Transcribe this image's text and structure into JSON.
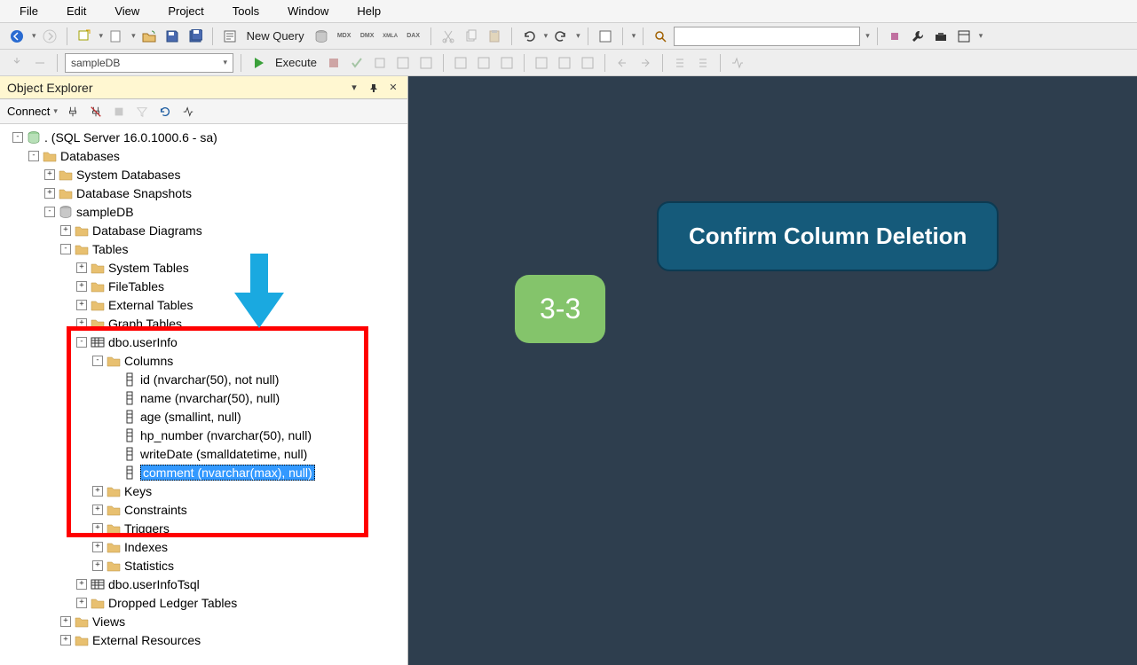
{
  "menu": {
    "items": [
      "File",
      "Edit",
      "View",
      "Project",
      "Tools",
      "Window",
      "Help"
    ]
  },
  "toolbar": {
    "new_query": "New Query",
    "search_placeholder": ""
  },
  "toolbar2": {
    "db_selector": "sampleDB",
    "execute": "Execute"
  },
  "object_explorer": {
    "title": "Object Explorer",
    "connect": "Connect",
    "tree": [
      {
        "depth": 0,
        "ex": "-",
        "icon": "server",
        "label": ". (SQL Server 16.0.1000.6 - sa)"
      },
      {
        "depth": 1,
        "ex": "-",
        "icon": "folder",
        "label": "Databases"
      },
      {
        "depth": 2,
        "ex": "+",
        "icon": "folder",
        "label": "System Databases"
      },
      {
        "depth": 2,
        "ex": "+",
        "icon": "folder",
        "label": "Database Snapshots"
      },
      {
        "depth": 2,
        "ex": "-",
        "icon": "db",
        "label": "sampleDB"
      },
      {
        "depth": 3,
        "ex": "+",
        "icon": "folder",
        "label": "Database Diagrams"
      },
      {
        "depth": 3,
        "ex": "-",
        "icon": "folder",
        "label": "Tables"
      },
      {
        "depth": 4,
        "ex": "+",
        "icon": "folder",
        "label": "System Tables"
      },
      {
        "depth": 4,
        "ex": "+",
        "icon": "folder",
        "label": "FileTables"
      },
      {
        "depth": 4,
        "ex": "+",
        "icon": "folder",
        "label": "External Tables"
      },
      {
        "depth": 4,
        "ex": "+",
        "icon": "folder",
        "label": "Graph Tables"
      },
      {
        "depth": 4,
        "ex": "-",
        "icon": "table",
        "label": "dbo.userInfo"
      },
      {
        "depth": 5,
        "ex": "-",
        "icon": "folder",
        "label": "Columns"
      },
      {
        "depth": 6,
        "ex": "",
        "icon": "col",
        "label": "id (nvarchar(50), not null)"
      },
      {
        "depth": 6,
        "ex": "",
        "icon": "col",
        "label": "name (nvarchar(50), null)"
      },
      {
        "depth": 6,
        "ex": "",
        "icon": "col",
        "label": "age (smallint, null)"
      },
      {
        "depth": 6,
        "ex": "",
        "icon": "col",
        "label": "hp_number (nvarchar(50), null)"
      },
      {
        "depth": 6,
        "ex": "",
        "icon": "col",
        "label": "writeDate (smalldatetime, null)"
      },
      {
        "depth": 6,
        "ex": "",
        "icon": "col",
        "label": "comment (nvarchar(max), null)",
        "selected": true
      },
      {
        "depth": 5,
        "ex": "+",
        "icon": "folder",
        "label": "Keys"
      },
      {
        "depth": 5,
        "ex": "+",
        "icon": "folder",
        "label": "Constraints"
      },
      {
        "depth": 5,
        "ex": "+",
        "icon": "folder",
        "label": "Triggers"
      },
      {
        "depth": 5,
        "ex": "+",
        "icon": "folder",
        "label": "Indexes"
      },
      {
        "depth": 5,
        "ex": "+",
        "icon": "folder",
        "label": "Statistics"
      },
      {
        "depth": 4,
        "ex": "+",
        "icon": "table",
        "label": "dbo.userInfoTsql"
      },
      {
        "depth": 4,
        "ex": "+",
        "icon": "folder",
        "label": "Dropped Ledger Tables"
      },
      {
        "depth": 3,
        "ex": "+",
        "icon": "folder",
        "label": "Views"
      },
      {
        "depth": 3,
        "ex": "+",
        "icon": "folder",
        "label": "External Resources"
      }
    ]
  },
  "annotations": {
    "step_badge": "3-3",
    "callout": "Confirm Column Deletion"
  },
  "colors": {
    "accent": "#3399ff",
    "title_bg": "#fff7d1",
    "canvas_bg": "#2e3e4e",
    "badge_green": "#84c46b",
    "callout_blue": "#155a7a",
    "annotation_red": "#ff0000",
    "arrow_blue": "#1aa9e0"
  }
}
